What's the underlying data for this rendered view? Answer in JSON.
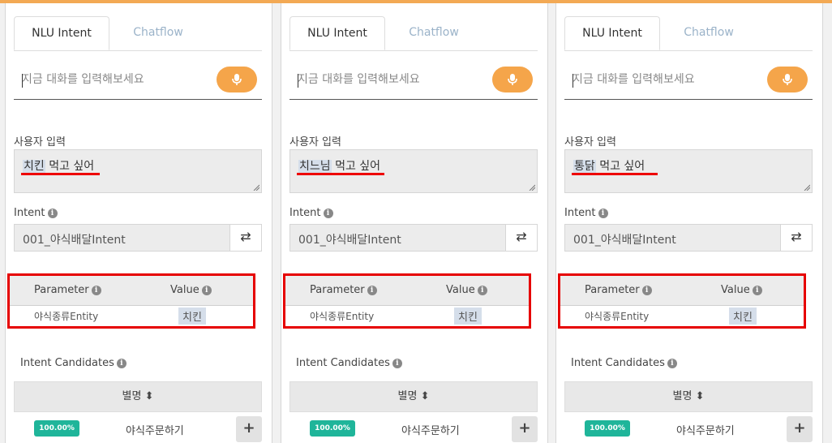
{
  "tabs": {
    "nlu": "NLU Intent",
    "chatflow": "Chatflow"
  },
  "input": {
    "placeholder": "지금 대화를 입력해보세요"
  },
  "labels": {
    "user_input": "사용자 입력",
    "intent": "Intent",
    "parameter": "Parameter",
    "value": "Value",
    "intent_candidates": "Intent Candidates",
    "alias": "별명 ⬍",
    "info": "i",
    "swap": "⇄",
    "plus": "+"
  },
  "panels": [
    {
      "user_highlight": "치킨",
      "user_rest": " 먹고 싶어",
      "intent": "001_야식배달Intent",
      "param_name": "야식종류Entity",
      "param_value": "치킨",
      "candidate": {
        "score": "100.00%",
        "name": "야식주문하기"
      }
    },
    {
      "user_highlight": "치느님",
      "user_rest": " 먹고 싶어",
      "intent": "001_야식배달Intent",
      "param_name": "야식종류Entity",
      "param_value": "치킨",
      "candidate": {
        "score": "100.00%",
        "name": "야식주문하기"
      }
    },
    {
      "user_highlight": "통닭",
      "user_rest": " 먹고 싶어",
      "intent": "001_야식배달Intent",
      "param_name": "야식종류Entity",
      "param_value": "치킨",
      "candidate": {
        "score": "100.00%",
        "name": "야식주문하기"
      }
    }
  ],
  "colors": {
    "accent": "#f5a54a",
    "highlight_bg": "#d5deea",
    "annotation_red": "#e60000",
    "score_badge": "#1fb59a"
  },
  "icons": [
    "microphone-icon",
    "info-icon",
    "swap-icon",
    "sort-icon",
    "plus-icon",
    "resize-grip-icon"
  ]
}
